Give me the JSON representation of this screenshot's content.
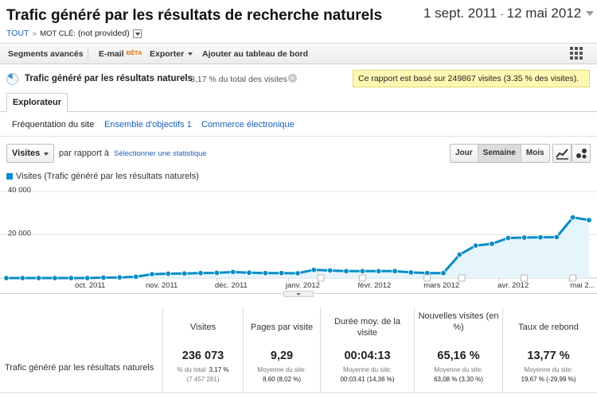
{
  "header": {
    "title": "Trafic généré par les résultats de recherche naturels",
    "date_start": "1 sept. 2011",
    "date_sep": "-",
    "date_end": "12 mai 2012",
    "breadcrumb": {
      "root": "TOUT",
      "separator": "»",
      "keyword_label": "MOT CLÉ:",
      "keyword_value": "(not provided)"
    }
  },
  "toolbar": {
    "segments": "Segments avancés",
    "email": "E-mail",
    "email_badge": "BÊTA",
    "export": "Exporter",
    "dashboard": "Ajouter au tableau de bord"
  },
  "report": {
    "name": "Trafic généré par les résultats naturels",
    "share": "3,17 % du total des visites",
    "sample_notice": "Ce rapport est basé sur 249867 visites (3.35 % des visites)."
  },
  "tabs": {
    "explorer": "Explorateur",
    "subtabs": [
      "Fréquentation du site",
      "Ensemble d'objectifs 1",
      "Commerce électronique"
    ]
  },
  "controls": {
    "metric": "Visites",
    "versus": "par rapport à",
    "select_stat": "Sélectionner une statistique",
    "periods": [
      "Jour",
      "Semaine",
      "Mois"
    ],
    "selected_period": "Semaine"
  },
  "colors": {
    "series": "#058dc7",
    "fill": "#e6f4fb",
    "accent_link": "#1a61b8",
    "notice_bg": "#fff8b3"
  },
  "chart_data": {
    "type": "area",
    "legend": "Visites (Trafic généré par les résultats naturels)",
    "ylim": [
      0,
      40000
    ],
    "yticks": [
      {
        "value": 40000,
        "label": "40 000"
      },
      {
        "value": 20000,
        "label": "20 000"
      }
    ],
    "xlabels": [
      {
        "label": "oct. 2011",
        "date": "2011-10-01"
      },
      {
        "label": "nov. 2011",
        "date": "2011-11-01"
      },
      {
        "label": "déc. 2011",
        "date": "2011-12-01"
      },
      {
        "label": "janv. 2012",
        "date": "2012-01-01"
      },
      {
        "label": "févr. 2012",
        "date": "2012-02-01"
      },
      {
        "label": "mars 2012",
        "date": "2012-03-01"
      },
      {
        "label": "avr. 2012",
        "date": "2012-04-01"
      },
      {
        "label": "mai 2...",
        "date": "2012-05-01"
      }
    ],
    "annotation_dates": [
      "2012-01-15",
      "2012-02-02",
      "2012-03-01",
      "2012-03-16",
      "2012-04-12",
      "2012-05-03"
    ],
    "series": [
      {
        "name": "Visites",
        "dates": [
          "2011-09-01",
          "2011-09-08",
          "2011-09-15",
          "2011-09-22",
          "2011-09-29",
          "2011-10-06",
          "2011-10-13",
          "2011-10-20",
          "2011-10-27",
          "2011-11-03",
          "2011-11-10",
          "2011-11-17",
          "2011-11-24",
          "2011-12-01",
          "2011-12-08",
          "2011-12-15",
          "2011-12-22",
          "2011-12-29",
          "2012-01-05",
          "2012-01-12",
          "2012-01-19",
          "2012-01-26",
          "2012-02-02",
          "2012-02-09",
          "2012-02-16",
          "2012-02-23",
          "2012-03-01",
          "2012-03-08",
          "2012-03-15",
          "2012-03-22",
          "2012-03-29",
          "2012-04-05",
          "2012-04-12",
          "2012-04-19",
          "2012-04-26",
          "2012-05-03",
          "2012-05-10"
        ],
        "values": [
          0,
          0,
          0,
          0,
          0,
          0,
          200,
          300,
          600,
          1800,
          2000,
          2100,
          2300,
          2400,
          2800,
          2500,
          2300,
          2300,
          2200,
          3800,
          3500,
          3200,
          3200,
          3200,
          3200,
          2600,
          2300,
          2300,
          10800,
          15000,
          15800,
          18500,
          18700,
          18800,
          18900,
          28000,
          26800,
          25000
        ]
      }
    ]
  },
  "summary": {
    "row_label": "Trafic généré par les résultats naturels",
    "columns": [
      {
        "header": "Visites",
        "value": "236 073",
        "sub1_label": "% du total:",
        "sub1_value": "3,17 %",
        "sub2": "(7 457 281)"
      },
      {
        "header": "Pages par visite",
        "value": "9,29",
        "sub1_label": "Moyenne du site:",
        "sub1_value": "",
        "sub2": "8,60 (8,02 %)"
      },
      {
        "header": "Durée moy. de la visite",
        "value": "00:04:13",
        "sub1_label": "Moyenne du site:",
        "sub1_value": "",
        "sub2": "00:03:41 (14,36 %)"
      },
      {
        "header": "Nouvelles visites (en %)",
        "value": "65,16 %",
        "sub1_label": "Moyenne du site:",
        "sub1_value": "",
        "sub2": "63,08 % (3,30 %)"
      },
      {
        "header": "Taux de rebond",
        "value": "13,77 %",
        "sub1_label": "Moyenne du site:",
        "sub1_value": "",
        "sub2": "19,67 % (-29,99 %)"
      }
    ]
  }
}
